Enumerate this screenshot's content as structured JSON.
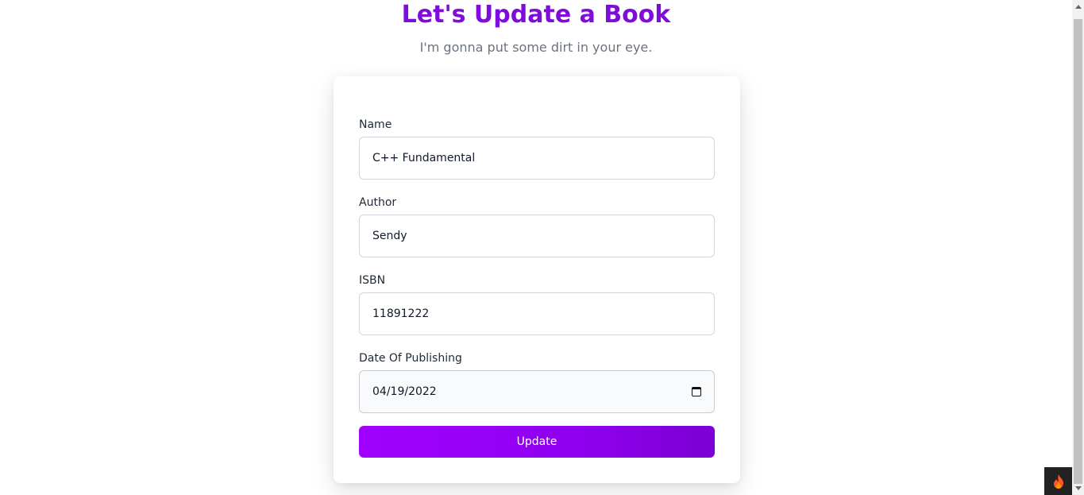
{
  "header": {
    "title": "Let's Update a Book",
    "subtitle": "I'm gonna put some dirt in your eye."
  },
  "form": {
    "name": {
      "label": "Name",
      "value": "C++ Fundamental"
    },
    "author": {
      "label": "Author",
      "value": "Sendy"
    },
    "isbn": {
      "label": "ISBN",
      "value": "11891222"
    },
    "date": {
      "label": "Date Of Publishing",
      "value": "04/19/2022"
    },
    "submit_label": "Update"
  },
  "colors": {
    "title": "#7e0ddb",
    "button": "#a100ff"
  },
  "icons": {
    "date_picker": "calendar-icon",
    "badge": "flame-icon"
  }
}
